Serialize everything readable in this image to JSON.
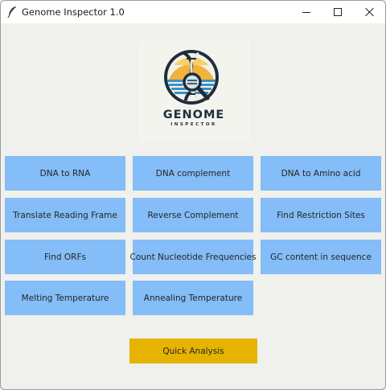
{
  "window": {
    "title": "Genome Inspector 1.0",
    "icons": {
      "app": "feather-icon",
      "minimize": "minimize-icon",
      "maximize": "maximize-icon",
      "close": "close-icon"
    }
  },
  "logo": {
    "title": "GENOME",
    "subtitle": "INSPECTOR",
    "icons": [
      "dna-helix-icon",
      "magnifying-glass-icon"
    ]
  },
  "buttons": {
    "dna_to_rna": "DNA to RNA",
    "dna_complement": "DNA complement",
    "dna_to_amino_acid": "DNA to Amino acid",
    "translate_reading_frame": "Translate Reading Frame",
    "reverse_complement": "Reverse Complement",
    "find_restriction_sites": "Find Restriction Sites",
    "find_orfs": "Find ORFs",
    "count_nucleotide_frequencies": "Count Nucleotide Frequencies",
    "gc_content": "GC content in sequence",
    "melting_temperature": "Melting Temperature",
    "annealing_temperature": "Annealing Temperature",
    "quick_analysis": "Quick Analysis"
  },
  "colors": {
    "button_blue": "#84bdf7",
    "quick_analysis_gold": "#e5b300",
    "window_background": "#f0f0ec"
  }
}
